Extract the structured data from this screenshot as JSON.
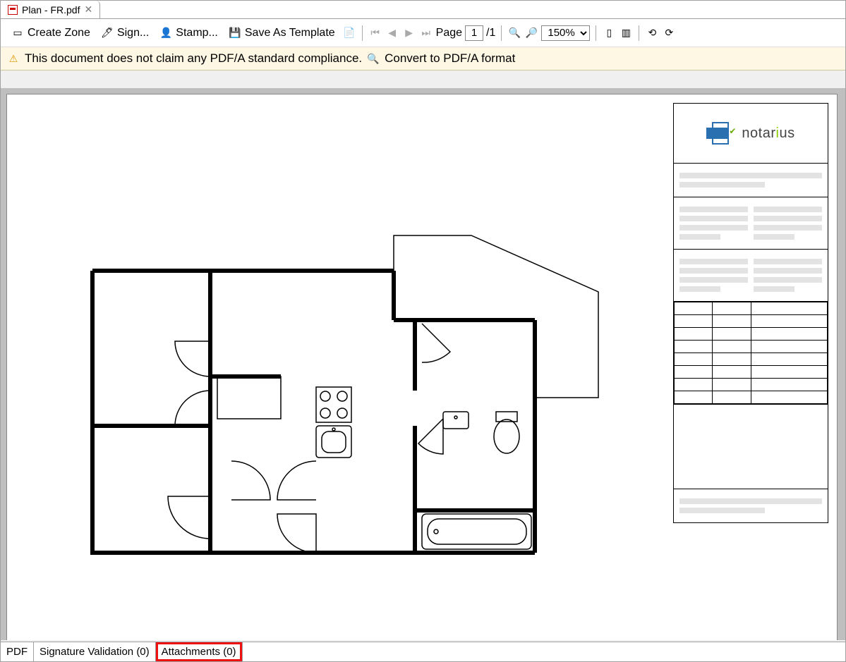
{
  "tab": {
    "filename": "Plan - FR.pdf"
  },
  "toolbar": {
    "create_zone": "Create Zone",
    "sign": "Sign...",
    "stamp": "Stamp...",
    "save_template": "Save As Template",
    "page_label": "Page",
    "page_current": "1",
    "page_total": "/1",
    "zoom": "150%"
  },
  "banner": {
    "message": "This document does not claim any PDF/A standard compliance.",
    "action": "Convert to PDF/A format"
  },
  "titleblock": {
    "brand": "notarius"
  },
  "bottom": {
    "pdf": "PDF",
    "sigval": "Signature Validation (0)",
    "attach": "Attachments (0)"
  }
}
